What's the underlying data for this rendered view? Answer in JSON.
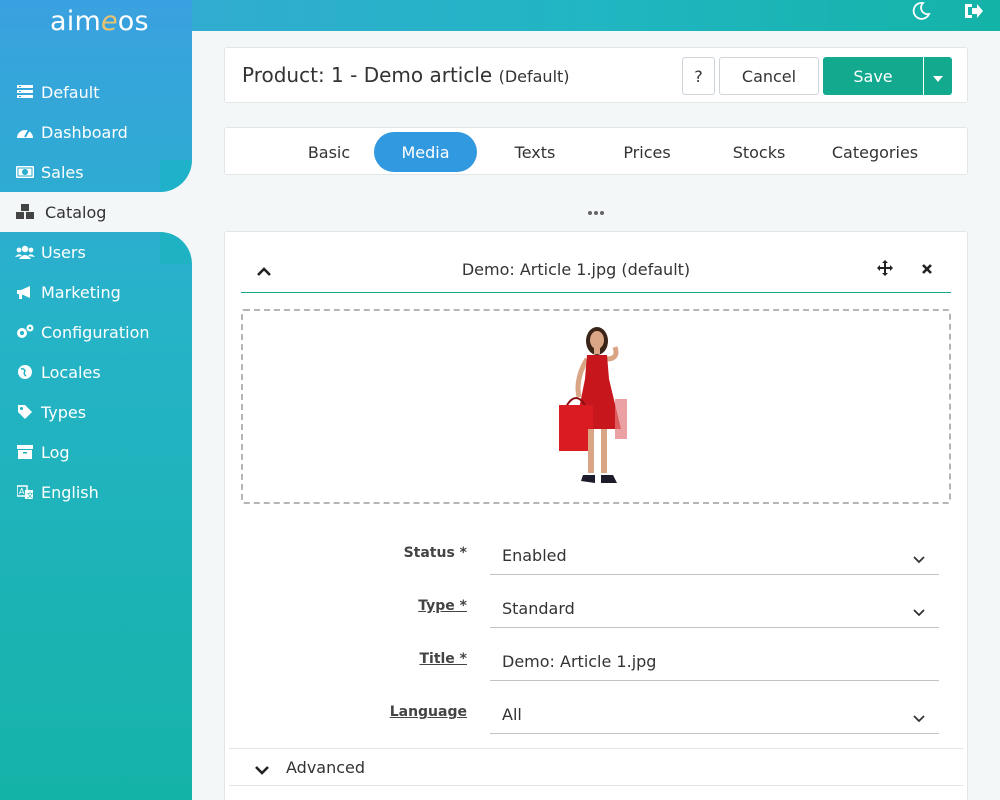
{
  "app": {
    "logo_text_a": "aim",
    "logo_text_e": "e",
    "logo_text_b": "os",
    "theme_toggle_icon": "moon-icon",
    "logout_icon": "sign-out-icon"
  },
  "sidebar": {
    "items": [
      {
        "label": "Default",
        "icon": "site-icon"
      },
      {
        "label": "Dashboard",
        "icon": "dashboard-icon"
      },
      {
        "label": "Sales",
        "icon": "money-icon"
      },
      {
        "label": "Catalog",
        "icon": "cubes-icon"
      },
      {
        "label": "Users",
        "icon": "users-icon"
      },
      {
        "label": "Marketing",
        "icon": "bullhorn-icon"
      },
      {
        "label": "Configuration",
        "icon": "cogs-icon"
      },
      {
        "label": "Locales",
        "icon": "globe-icon"
      },
      {
        "label": "Types",
        "icon": "tag-icon"
      },
      {
        "label": "Log",
        "icon": "archive-icon"
      },
      {
        "label": "English",
        "icon": "language-icon"
      }
    ],
    "active": "Catalog"
  },
  "header": {
    "title": "Product: 1 - Demo article",
    "title_suffix": "(Default)",
    "help_label": "?",
    "cancel_label": "Cancel",
    "save_label": "Save"
  },
  "tabs": [
    {
      "label": "Basic"
    },
    {
      "label": "Media"
    },
    {
      "label": "Texts"
    },
    {
      "label": "Prices"
    },
    {
      "label": "Stocks"
    },
    {
      "label": "Categories"
    }
  ],
  "active_tab": "Media",
  "media": {
    "title": "Demo: Article 1.jpg (default)",
    "form": {
      "status_label": "Status *",
      "status_value": "Enabled",
      "type_label": "Type *",
      "type_value": "Standard",
      "title_label": "Title *",
      "title_value": "Demo: Article 1.jpg",
      "language_label": "Language",
      "language_value": "All"
    },
    "advanced_label": "Advanced"
  },
  "colors": {
    "accent_green": "#12a98f",
    "tab_active": "#3199df",
    "sidebar_top": "#3aa1e0",
    "sidebar_bottom": "#14b3a7"
  }
}
